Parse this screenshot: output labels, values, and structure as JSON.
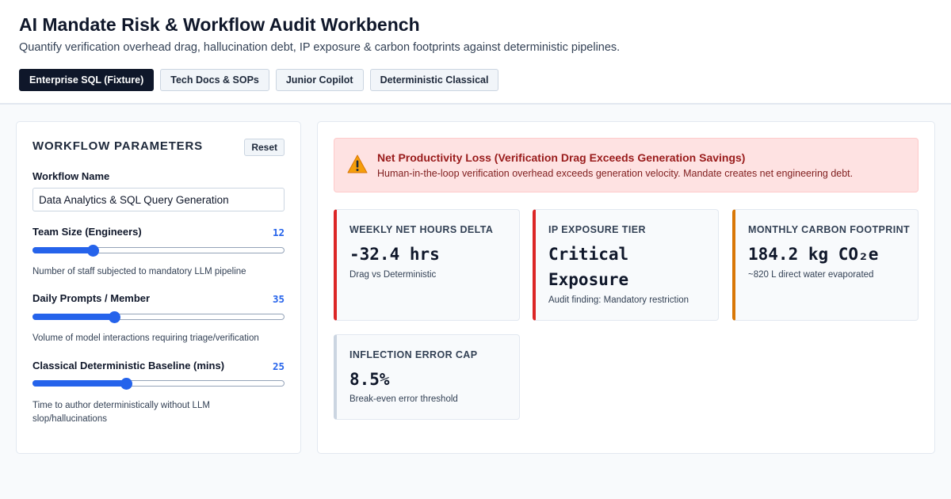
{
  "header": {
    "title": "AI Mandate Risk & Workflow Audit Workbench",
    "subtitle": "Quantify verification overhead drag, hallucination debt, IP exposure & carbon footprints against deterministic pipelines.",
    "tabs": [
      {
        "label": "Enterprise SQL (Fixture)",
        "active": true
      },
      {
        "label": "Tech Docs & SOPs",
        "active": false
      },
      {
        "label": "Junior Copilot",
        "active": false
      },
      {
        "label": "Deterministic Classical",
        "active": false
      }
    ]
  },
  "params": {
    "title": "WORKFLOW PARAMETERS",
    "reset_label": "Reset",
    "workflow_name_label": "Workflow Name",
    "workflow_name_value": "Data Analytics & SQL Query Generation",
    "team_size": {
      "label": "Team Size (Engineers)",
      "value": "12",
      "fill_fraction": 0.24,
      "help": "Number of staff subjected to mandatory LLM pipeline"
    },
    "daily_prompts": {
      "label": "Daily Prompts / Member",
      "value": "35",
      "fill_fraction": 0.325,
      "help": "Volume of model interactions requiring triage/verification"
    },
    "baseline": {
      "label": "Classical Deterministic Baseline (mins)",
      "value": "25",
      "fill_fraction": 0.37,
      "help": "Time to author deterministically without LLM slop/hallucinations"
    }
  },
  "alert": {
    "icon": "warning-icon",
    "title": "Net Productivity Loss (Verification Drag Exceeds Generation Savings)",
    "text": "Human-in-the-loop verification overhead exceeds generation velocity. Mandate creates net engineering debt."
  },
  "metrics": [
    {
      "label": "WEEKLY NET HOURS DELTA",
      "value": "-32.4 hrs",
      "sub": "Drag vs Deterministic",
      "accent": "#dc2626"
    },
    {
      "label": "IP EXPOSURE TIER",
      "value": "Critical Exposure",
      "sub": "Audit finding: Mandatory restriction",
      "accent": "#dc2626"
    },
    {
      "label": "MONTHLY CARBON FOOTPRINT",
      "value": "184.2 kg CO₂e",
      "sub": "~820 L direct water evaporated",
      "accent": "#d97706"
    },
    {
      "label": "INFLECTION ERROR CAP",
      "value": "8.5%",
      "sub": "Break-even error threshold",
      "accent": "#cbd5e1"
    }
  ],
  "colors": {
    "accent": "#2563eb",
    "danger": "#dc2626",
    "warning": "#d97706",
    "dark": "#0f172a"
  }
}
